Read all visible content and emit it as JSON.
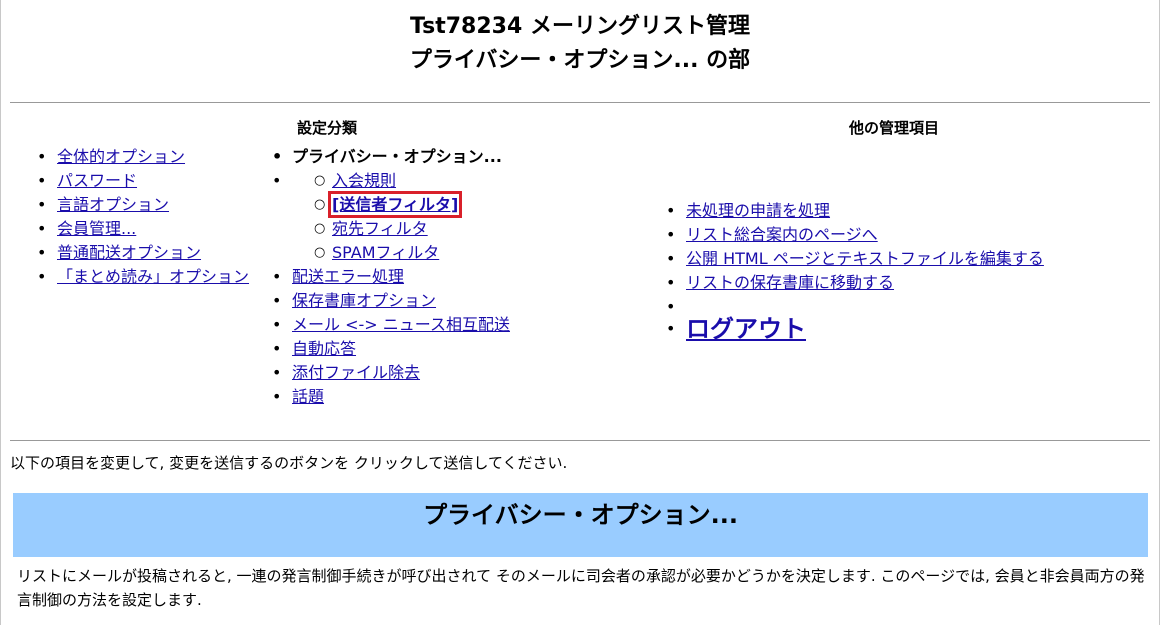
{
  "header": {
    "title_line1": "Tst78234 メーリングリスト管理",
    "title_line2": "プライバシー・オプション... の部"
  },
  "categories": {
    "heading": "設定分類",
    "left_items": [
      {
        "label": "全体的オプション"
      },
      {
        "label": "パスワード"
      },
      {
        "label": "言語オプション"
      },
      {
        "label": "会員管理..."
      },
      {
        "label": "普通配送オプション"
      },
      {
        "label": "「まとめ読み」オプション"
      }
    ],
    "current_item": "プライバシー・オプション...",
    "sub_items": [
      {
        "label": "入会規則",
        "selected": false
      },
      {
        "label": "[送信者フィルタ]",
        "selected": true
      },
      {
        "label": "宛先フィルタ",
        "selected": false
      },
      {
        "label": "SPAMフィルタ",
        "selected": false
      }
    ],
    "right_items": [
      {
        "label": "配送エラー処理"
      },
      {
        "label": "保存書庫オプション"
      },
      {
        "label": "メール <-> ニュース相互配送"
      },
      {
        "label": "自動応答"
      },
      {
        "label": "添付ファイル除去"
      },
      {
        "label": "話題"
      }
    ]
  },
  "other_admin": {
    "heading": "他の管理項目",
    "items": [
      {
        "label": "未処理の申請を処理"
      },
      {
        "label": "リスト総合案内のページへ"
      },
      {
        "label": "公開 HTML ページとテキストファイルを編集する"
      },
      {
        "label": "リストの保存書庫に移動する"
      }
    ],
    "logout": "ログアウト"
  },
  "instruction": "以下の項目を変更して, 変更を送信するのボタンを クリックして送信してください.",
  "section": {
    "title": "プライバシー・オプション...",
    "description": "リストにメールが投稿されると, 一連の発言制御手続きが呼び出されて そのメールに司会者の承認が必要かどうかを決定します. このページでは, 会員と非会員両方の発言制御の方法を設定します."
  },
  "colors": {
    "banner": "#99ccff",
    "link": "#1a0dab",
    "highlight": "#d9202a"
  }
}
